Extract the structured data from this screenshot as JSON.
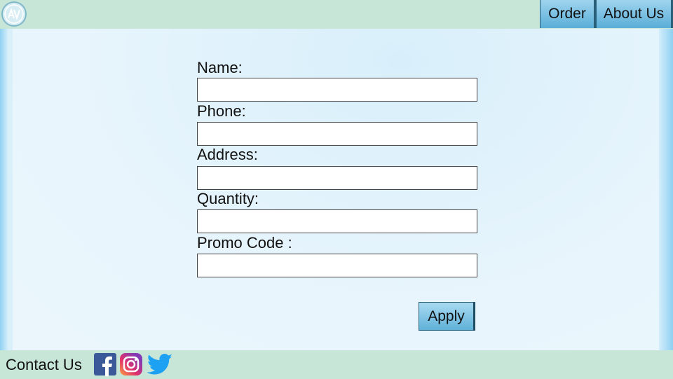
{
  "header": {
    "logo_icon": "av-logo-icon",
    "nav": [
      {
        "label": "Order"
      },
      {
        "label": "About Us"
      }
    ]
  },
  "form": {
    "fields": [
      {
        "label": "Name:",
        "value": "",
        "placeholder": ""
      },
      {
        "label": "Phone:",
        "value": "",
        "placeholder": ""
      },
      {
        "label": "Address:",
        "value": "",
        "placeholder": ""
      },
      {
        "label": "Quantity:",
        "value": "",
        "placeholder": ""
      },
      {
        "label": "Promo Code :",
        "value": "",
        "placeholder": ""
      }
    ],
    "apply_label": "Apply"
  },
  "footer": {
    "contact_label": "Contact Us",
    "social": [
      "facebook-icon",
      "instagram-icon",
      "twitter-icon"
    ]
  },
  "colors": {
    "bar": "#c8e6d8",
    "button": "#5fb1d9",
    "facebook": "#3b5998",
    "twitter": "#1da1f2"
  }
}
